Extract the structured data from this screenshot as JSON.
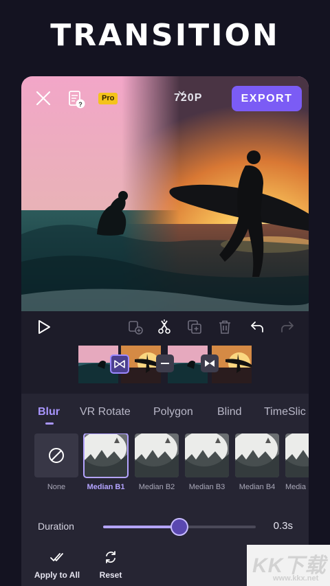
{
  "banner": {
    "title": "TRANSITION"
  },
  "header": {
    "pro_badge": "Pro",
    "resolution": "720P",
    "export_label": "EXPORT"
  },
  "toolbar": {
    "icons": [
      "play-icon",
      "add-clip-icon",
      "split-icon",
      "duplicate-icon",
      "delete-icon",
      "undo-icon",
      "redo-icon"
    ]
  },
  "tabs": [
    {
      "label": "Blur",
      "active": true
    },
    {
      "label": "VR Rotate",
      "active": false
    },
    {
      "label": "Polygon",
      "active": false
    },
    {
      "label": "Blind",
      "active": false
    },
    {
      "label": "TimeSlic",
      "active": false
    }
  ],
  "effects": [
    {
      "label": "None",
      "active": false
    },
    {
      "label": "Median B1",
      "active": true
    },
    {
      "label": "Median B2",
      "active": false
    },
    {
      "label": "Median B3",
      "active": false
    },
    {
      "label": "Median B4",
      "active": false
    },
    {
      "label": "Media",
      "active": false
    }
  ],
  "duration": {
    "label": "Duration",
    "value_text": "0.3s",
    "fraction": 0.5
  },
  "actions": {
    "apply_all": "Apply to All",
    "reset": "Reset"
  },
  "watermark": {
    "big": "KK下载",
    "small": "www.kkx.net"
  },
  "colors": {
    "accent": "#7b5cf5",
    "accent_light": "#b4a4ff",
    "pro": "#f4c31b",
    "panel": "#262533"
  }
}
